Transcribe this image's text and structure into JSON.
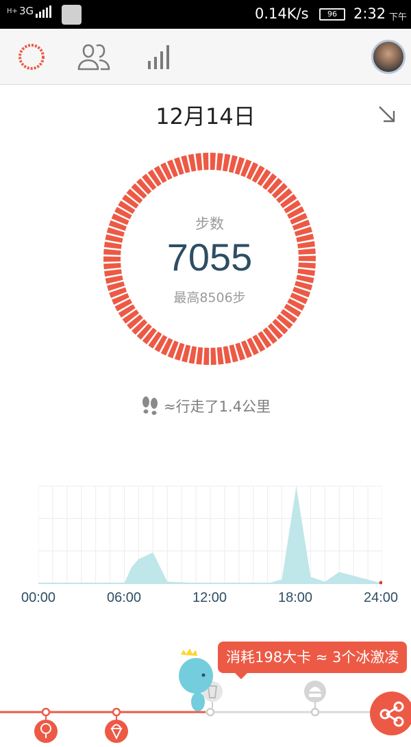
{
  "status_bar": {
    "network_type": "H+",
    "generation": "3G",
    "net_speed": "0.14K/s",
    "battery": "96",
    "time": "2:32",
    "ampm": "下午"
  },
  "nav": {
    "icons": [
      "ring-progress-icon",
      "friends-icon",
      "bar-stats-icon",
      "avatar"
    ]
  },
  "date": "12月14日",
  "steps": {
    "label": "步数",
    "value": "7055",
    "best": "最高8506步"
  },
  "distance_text": "≈行走了1.4公里",
  "chart_data": {
    "type": "area",
    "x_ticks": [
      "00:00",
      "06:00",
      "12:00",
      "18:00",
      "24:00"
    ],
    "x": [
      0,
      6,
      6.5,
      7,
      8,
      9,
      12,
      16,
      17,
      18,
      19,
      20,
      21,
      24
    ],
    "y": [
      0,
      0,
      20,
      30,
      38,
      2,
      0,
      0,
      5,
      120,
      8,
      2,
      14,
      0
    ],
    "grid": true
  },
  "calorie_bubble": "消耗198大卡 ≈ 3个冰激凌",
  "colors": {
    "accent": "#ec5a45",
    "chart_fill": "#bfe6e8",
    "value_text": "#2d4e63"
  }
}
